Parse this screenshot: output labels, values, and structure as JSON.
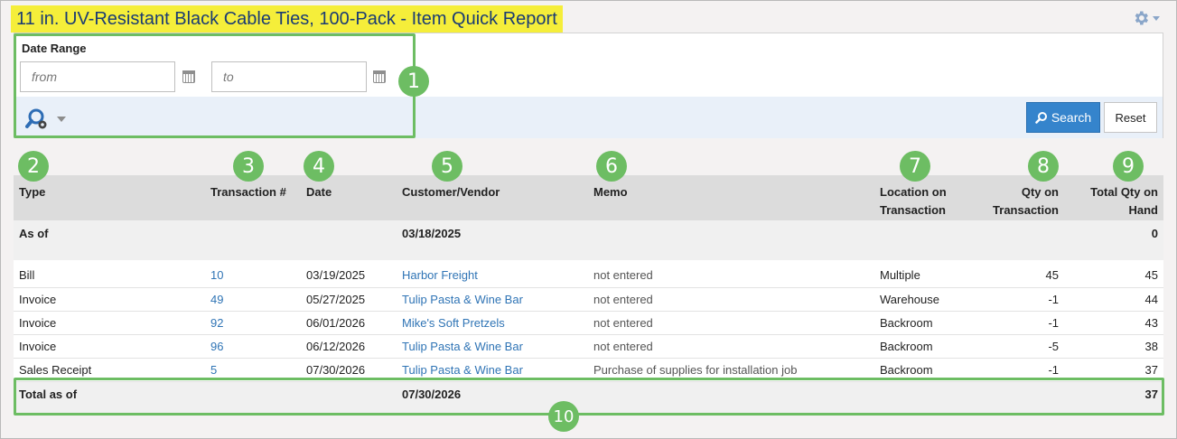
{
  "title": "11 in. UV-Resistant Black Cable Ties, 100-Pack - Item Quick Report",
  "filters": {
    "date_range_label": "Date Range",
    "from_placeholder": "from",
    "to_placeholder": "to",
    "search_label": "Search",
    "reset_label": "Reset"
  },
  "badges": [
    "1",
    "2",
    "3",
    "4",
    "5",
    "6",
    "7",
    "8",
    "9",
    "10"
  ],
  "columns": {
    "type": "Type",
    "transaction": "Transaction #",
    "date": "Date",
    "customer_vendor": "Customer/Vendor",
    "memo": "Memo",
    "location_line1": "Location on",
    "location_line2": "Transaction",
    "qty_txn_line1": "Qty on",
    "qty_txn_line2": "Transaction",
    "total_qty_line1": "Total Qty on",
    "total_qty_line2": "Hand"
  },
  "as_of": {
    "label": "As of",
    "date": "03/18/2025",
    "total": "0"
  },
  "rows": [
    {
      "type": "Bill",
      "txn": "10",
      "date": "03/19/2025",
      "party": "Harbor Freight",
      "memo": "not entered",
      "location": "Multiple",
      "qty": "45",
      "total": "45"
    },
    {
      "type": "Invoice",
      "txn": "49",
      "date": "05/27/2025",
      "party": "Tulip Pasta & Wine Bar",
      "memo": "not entered",
      "location": "Warehouse",
      "qty": "-1",
      "total": "44"
    },
    {
      "type": "Invoice",
      "txn": "92",
      "date": "06/01/2026",
      "party": "Mike's Soft Pretzels",
      "memo": "not entered",
      "location": "Backroom",
      "qty": "-1",
      "total": "43"
    },
    {
      "type": "Invoice",
      "txn": "96",
      "date": "06/12/2026",
      "party": "Tulip Pasta & Wine Bar",
      "memo": "not entered",
      "location": "Backroom",
      "qty": "-5",
      "total": "38"
    },
    {
      "type": "Sales Receipt",
      "txn": "5",
      "date": "07/30/2026",
      "party": "Tulip Pasta & Wine Bar",
      "memo": "Purchase of supplies for installation job",
      "location": "Backroom",
      "qty": "-1",
      "total": "37"
    }
  ],
  "total_as_of": {
    "label": "Total as of",
    "date": "07/30/2026",
    "total": "37"
  },
  "colors": {
    "highlight": "#f5ee3a",
    "annotation": "#6dbd63",
    "link": "#2f74b5",
    "primary_button": "#3584cc"
  },
  "icons": {
    "settings": "gear-icon",
    "advanced_search": "advanced-search-icon",
    "calendar": "calendar-icon",
    "search": "magnifier-icon"
  }
}
